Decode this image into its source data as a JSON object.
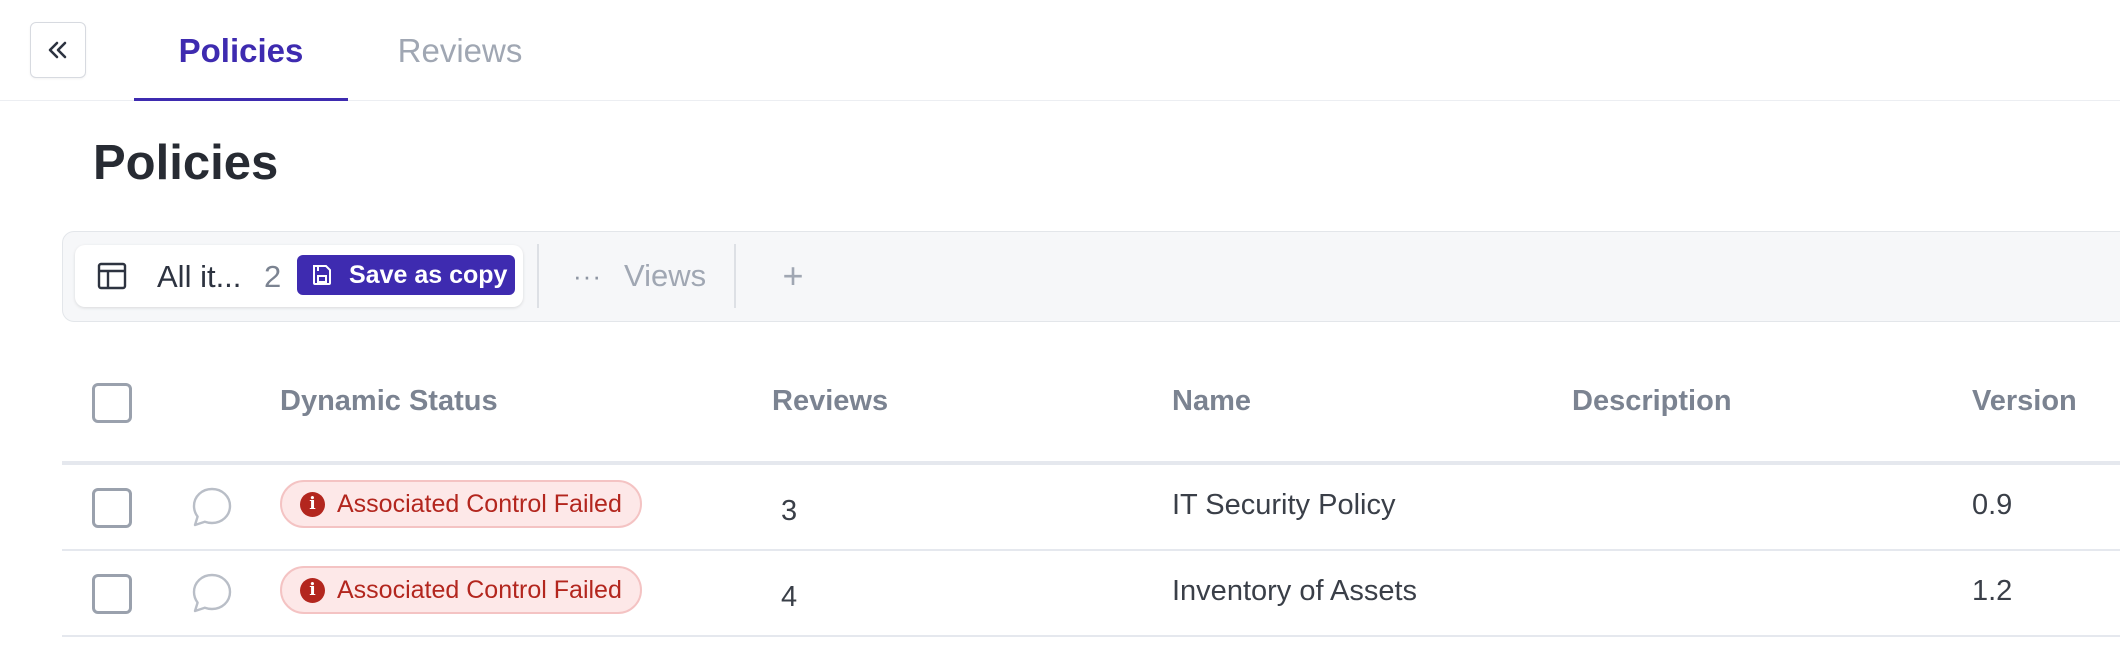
{
  "tabs": [
    {
      "label": "Policies",
      "active": true
    },
    {
      "label": "Reviews",
      "active": false
    }
  ],
  "page": {
    "title": "Policies"
  },
  "viewbar": {
    "current_view": "All it...",
    "count": "2",
    "save_copy_label": "Save as copy",
    "views_label": "Views",
    "add_label": "+"
  },
  "table": {
    "columns": [
      "Dynamic Status",
      "Reviews",
      "Name",
      "Description",
      "Version"
    ],
    "rows": [
      {
        "status": "Associated Control Failed",
        "reviews": "3",
        "name": "IT Security Policy",
        "description": "",
        "version": "0.9"
      },
      {
        "status": "Associated Control Failed",
        "reviews": "4",
        "name": "Inventory of Assets",
        "description": "",
        "version": "1.2"
      }
    ]
  },
  "colors": {
    "accent": "#3e2bb0",
    "status_error": "#b3261e",
    "status_error_bg": "#fde8e8"
  },
  "icons": {
    "collapse": "chevrons-left-icon",
    "table": "table-icon",
    "save": "floppy-disk-icon",
    "more": "ellipsis-icon",
    "comment": "comment-icon",
    "alert": "alert-circle-icon"
  }
}
